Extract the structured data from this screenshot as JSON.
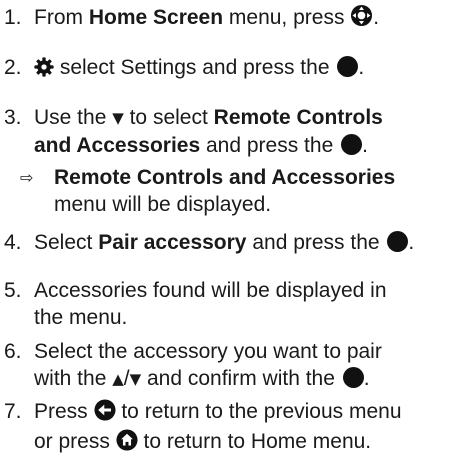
{
  "steps": [
    {
      "num": "1.",
      "t1": "From ",
      "b1": "Home Screen",
      "t2": " menu, press ",
      "t3": "."
    },
    {
      "num": "2.",
      "t1": " select Settings and press the ",
      "t2": "."
    },
    {
      "num": "3.",
      "t1": "Use the ",
      "t2": " to select ",
      "b1": "Remote Controls",
      "b2": "and Accessories",
      "t3": " and press the ",
      "t4": "."
    },
    {
      "num": "4.",
      "t1": "Select ",
      "b1": "Pair accessory",
      "t2": " and press the ",
      "t3": "."
    },
    {
      "num": "5.",
      "line1": "Accessories found will be displayed in",
      "line2": "the menu."
    },
    {
      "num": "6.",
      "line1": "Select the accessory you want to pair",
      "t1": "with the ",
      "t2": " and confirm with the ",
      "t3": "."
    },
    {
      "num": "7.",
      "t1": "Press ",
      "t2": " to return to the previous menu",
      "t3": "or press ",
      "t4": " to return to Home menu."
    }
  ],
  "result": {
    "arrow": "⇨",
    "bold": "Remote Controls and Accessories",
    "line2": "menu will be displayed."
  },
  "glyphs": {
    "down": "▼",
    "up": "▲",
    "slash": "/"
  },
  "icons": [
    "navigation-pad-icon",
    "gear-icon",
    "ok-button-icon",
    "down-arrow-icon",
    "up-arrow-icon",
    "back-button-icon",
    "home-button-icon"
  ]
}
